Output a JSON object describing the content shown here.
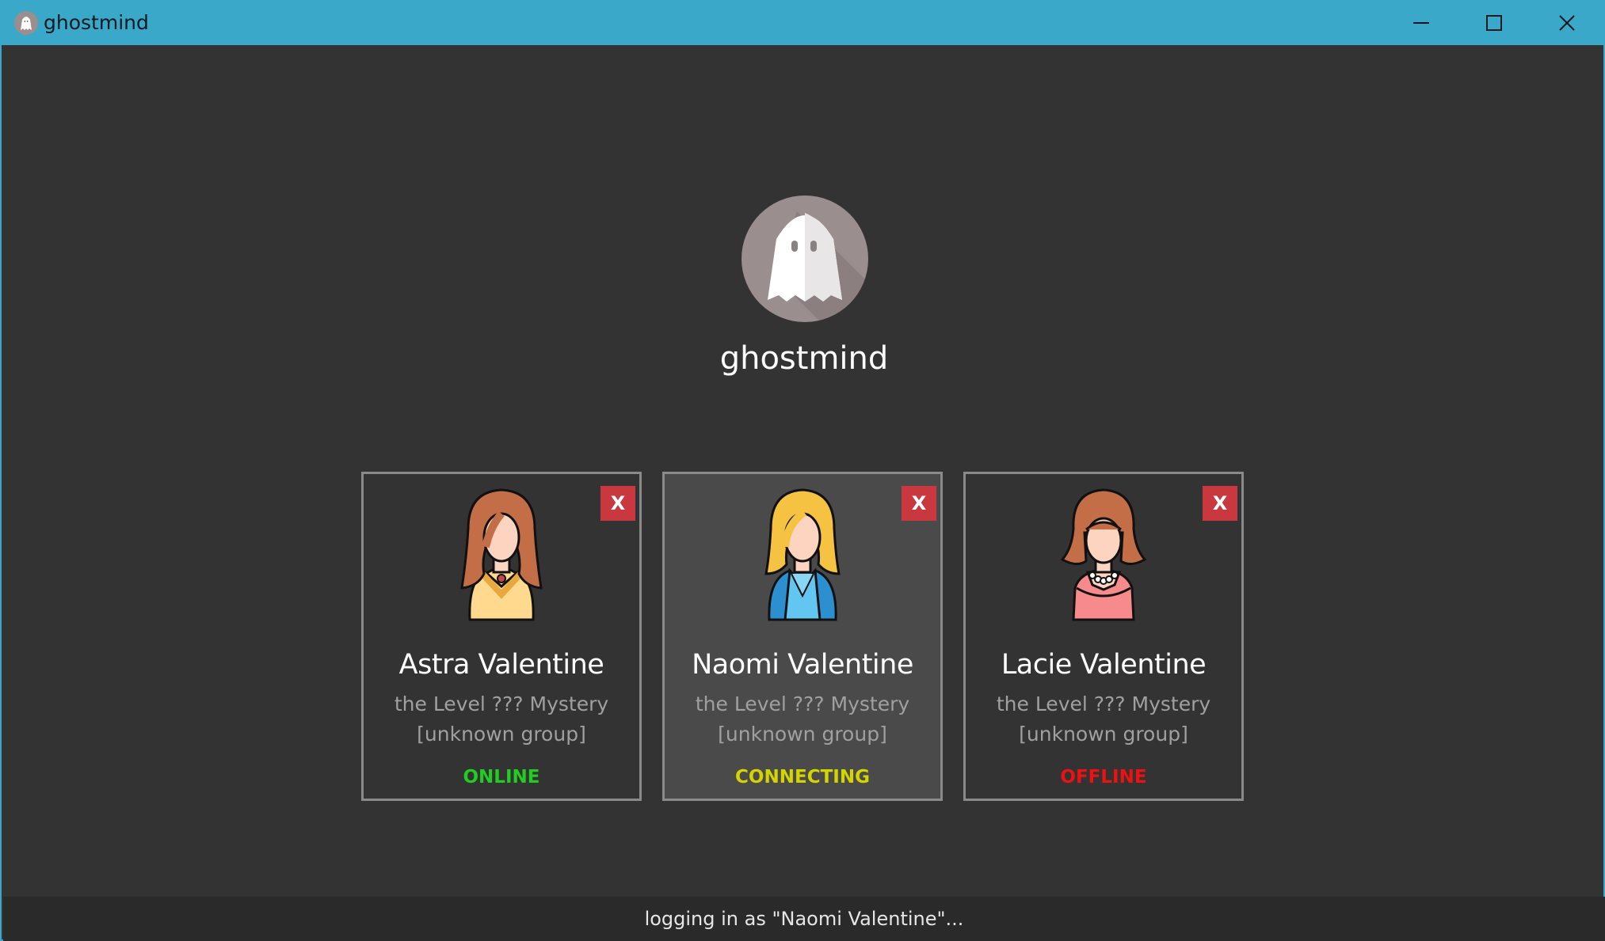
{
  "window": {
    "title": "ghostmind",
    "icon": "ghost-icon",
    "controls": {
      "minimize_icon": "minimize-icon",
      "maximize_icon": "maximize-icon",
      "close_icon": "close-icon"
    },
    "accent": "#3aa8c9"
  },
  "profile": {
    "username": "ghostmind",
    "avatar_icon": "ghost-icon"
  },
  "accounts": [
    {
      "name": "Astra Valentine",
      "line1": "the Level ??? Mystery",
      "line2": "[unknown group]",
      "status": "ONLINE",
      "status_color": "#22cc22",
      "remove_label": "X",
      "selected": false
    },
    {
      "name": "Naomi Valentine",
      "line1": "the Level ??? Mystery",
      "line2": "[unknown group]",
      "status": "CONNECTING",
      "status_color": "#d4d400",
      "remove_label": "X",
      "selected": true
    },
    {
      "name": "Lacie Valentine",
      "line1": "the Level ??? Mystery",
      "line2": "[unknown group]",
      "status": "OFFLINE",
      "status_color": "#ee1111",
      "remove_label": "X",
      "selected": false
    }
  ],
  "statusbar": {
    "text": "logging in as \"Naomi Valentine\"..."
  }
}
